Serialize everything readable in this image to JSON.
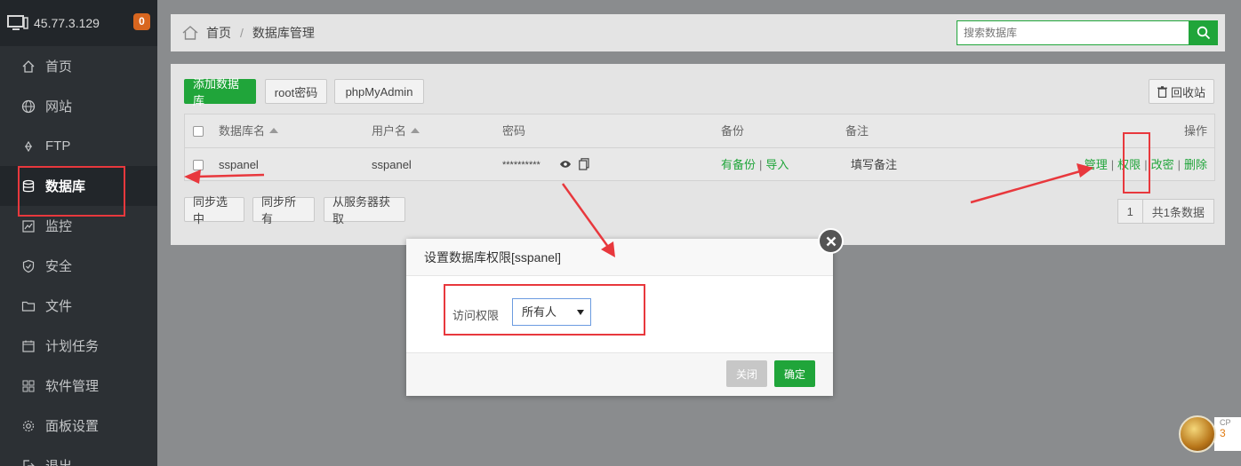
{
  "sidebar": {
    "ip": "45.77.3.129",
    "badge": "0",
    "items": [
      {
        "label": "首页",
        "icon": "home-icon"
      },
      {
        "label": "网站",
        "icon": "globe-icon"
      },
      {
        "label": "FTP",
        "icon": "ftp-icon"
      },
      {
        "label": "数据库",
        "icon": "database-icon",
        "active": true
      },
      {
        "label": "监控",
        "icon": "monitor-chart-icon"
      },
      {
        "label": "安全",
        "icon": "shield-icon"
      },
      {
        "label": "文件",
        "icon": "folder-icon"
      },
      {
        "label": "计划任务",
        "icon": "schedule-icon"
      },
      {
        "label": "软件管理",
        "icon": "grid-icon"
      },
      {
        "label": "面板设置",
        "icon": "gear-icon"
      },
      {
        "label": "退出",
        "icon": "logout-icon"
      }
    ]
  },
  "breadcrumb": {
    "home": "首页",
    "sep": "/",
    "current": "数据库管理"
  },
  "search": {
    "placeholder": "搜索数据库"
  },
  "toolbar": {
    "add": "添加数据库",
    "root": "root密码",
    "pma": "phpMyAdmin",
    "recycle": "回收站"
  },
  "table": {
    "headers": {
      "name": "数据库名",
      "user": "用户名",
      "password": "密码",
      "backup": "备份",
      "note": "备注",
      "ops": "操作"
    },
    "rows": [
      {
        "name": "sspanel",
        "user": "sspanel",
        "password": "**********",
        "has_backup": "有备份",
        "import": "导入",
        "note": "填写备注",
        "ops": [
          "管理",
          "权限",
          "改密",
          "删除"
        ]
      }
    ]
  },
  "bottom": {
    "sync_selected": "同步选中",
    "sync_all": "同步所有",
    "from_server": "从服务器获取"
  },
  "pager": {
    "page": "1",
    "total": "共1条数据"
  },
  "modal": {
    "title": "设置数据库权限[sspanel]",
    "field_label": "访问权限",
    "select_value": "所有人",
    "cancel": "关闭",
    "ok": "确定"
  },
  "widget": {
    "label": "CP",
    "value": "3"
  },
  "colors": {
    "accent": "#20a53a",
    "annotation": "#e8383d",
    "sidebar": "#2c3034"
  }
}
